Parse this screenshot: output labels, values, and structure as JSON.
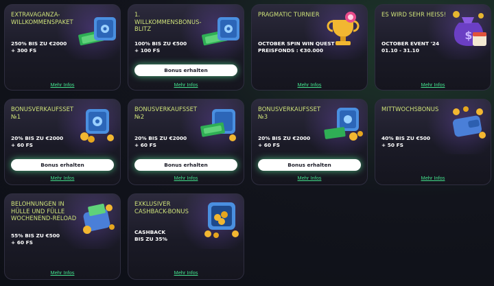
{
  "colors": {
    "accent_title": "#cfe37a",
    "link_green": "#43e08c",
    "button_bg": "#ffffff",
    "card_bg": "#1a1a26"
  },
  "cards": [
    {
      "title": "EXTRAVAGANZA-WILLKOMMENSPAKET",
      "line1": "250% BIS ZU €2000",
      "line2": "+ 300 FS",
      "button": "",
      "more": "Mehr Infos",
      "icon": "safe-with-cash-icon"
    },
    {
      "title": "1. WILLKOMMENSBONUS-BLITZ",
      "line1": "100% BIS ZU €500",
      "line2": "+ 100 FS",
      "button": "Bonus erhalten",
      "more": "Mehr Infos",
      "icon": "safe-with-cash-icon"
    },
    {
      "title": "PRAGMATIC TURNIER",
      "line1": "OCTOBER SPIN WIN QUEST",
      "line2": "PREISFONDS : €30.000",
      "button": "",
      "more": "Mehr Infos",
      "icon": "trophy-with-candy-icon"
    },
    {
      "title": "ES WIRD SEHR HEISS!",
      "line1": "OCTOBER EVENT '24",
      "line2": "01.10 - 31.10",
      "button": "",
      "more": "Mehr Infos",
      "icon": "money-bag-calendar-icon"
    },
    {
      "title": "BONUSVERKAUFSSET №1",
      "line1": "20% BIS ZU €2000",
      "line2": "+ 60 FS",
      "button": "Bonus erhalten",
      "more": "Mehr Infos",
      "icon": "safe-with-coins-icon"
    },
    {
      "title": "BONUSVERKAUFSSET №2",
      "line1": "20% BIS ZU €2000",
      "line2": "+ 60 FS",
      "button": "Bonus erhalten",
      "more": "Mehr Infos",
      "icon": "safe-with-cash-icon"
    },
    {
      "title": "BONUSVERKAUFSSET №3",
      "line1": "20% BIS ZU €2000",
      "line2": "+ 60 FS",
      "button": "Bonus erhalten",
      "more": "Mehr Infos",
      "icon": "safe-with-coins-cash-icon"
    },
    {
      "title": "MITTWOCHSBONUS",
      "line1": "40% BIS ZU €500",
      "line2": "+ 50 FS",
      "button": "",
      "more": "Mehr Infos",
      "icon": "wallet-with-coins-icon"
    },
    {
      "title": "BELOHNUNGEN IN HÜLLE UND FÜLLE WOCHENEND-RELOAD",
      "line1": "55% BIS ZU €500",
      "line2": "+ 60 FS",
      "button": "",
      "more": "Mehr Infos",
      "icon": "wallet-with-coins-icon"
    },
    {
      "title": "EXKLUSIVER CASHBACK-BONUS",
      "line1": "CASHBACK",
      "line2": "BIS ZU 35%",
      "button": "",
      "more": "Mehr Infos",
      "icon": "safe-full-of-coins-icon"
    }
  ]
}
